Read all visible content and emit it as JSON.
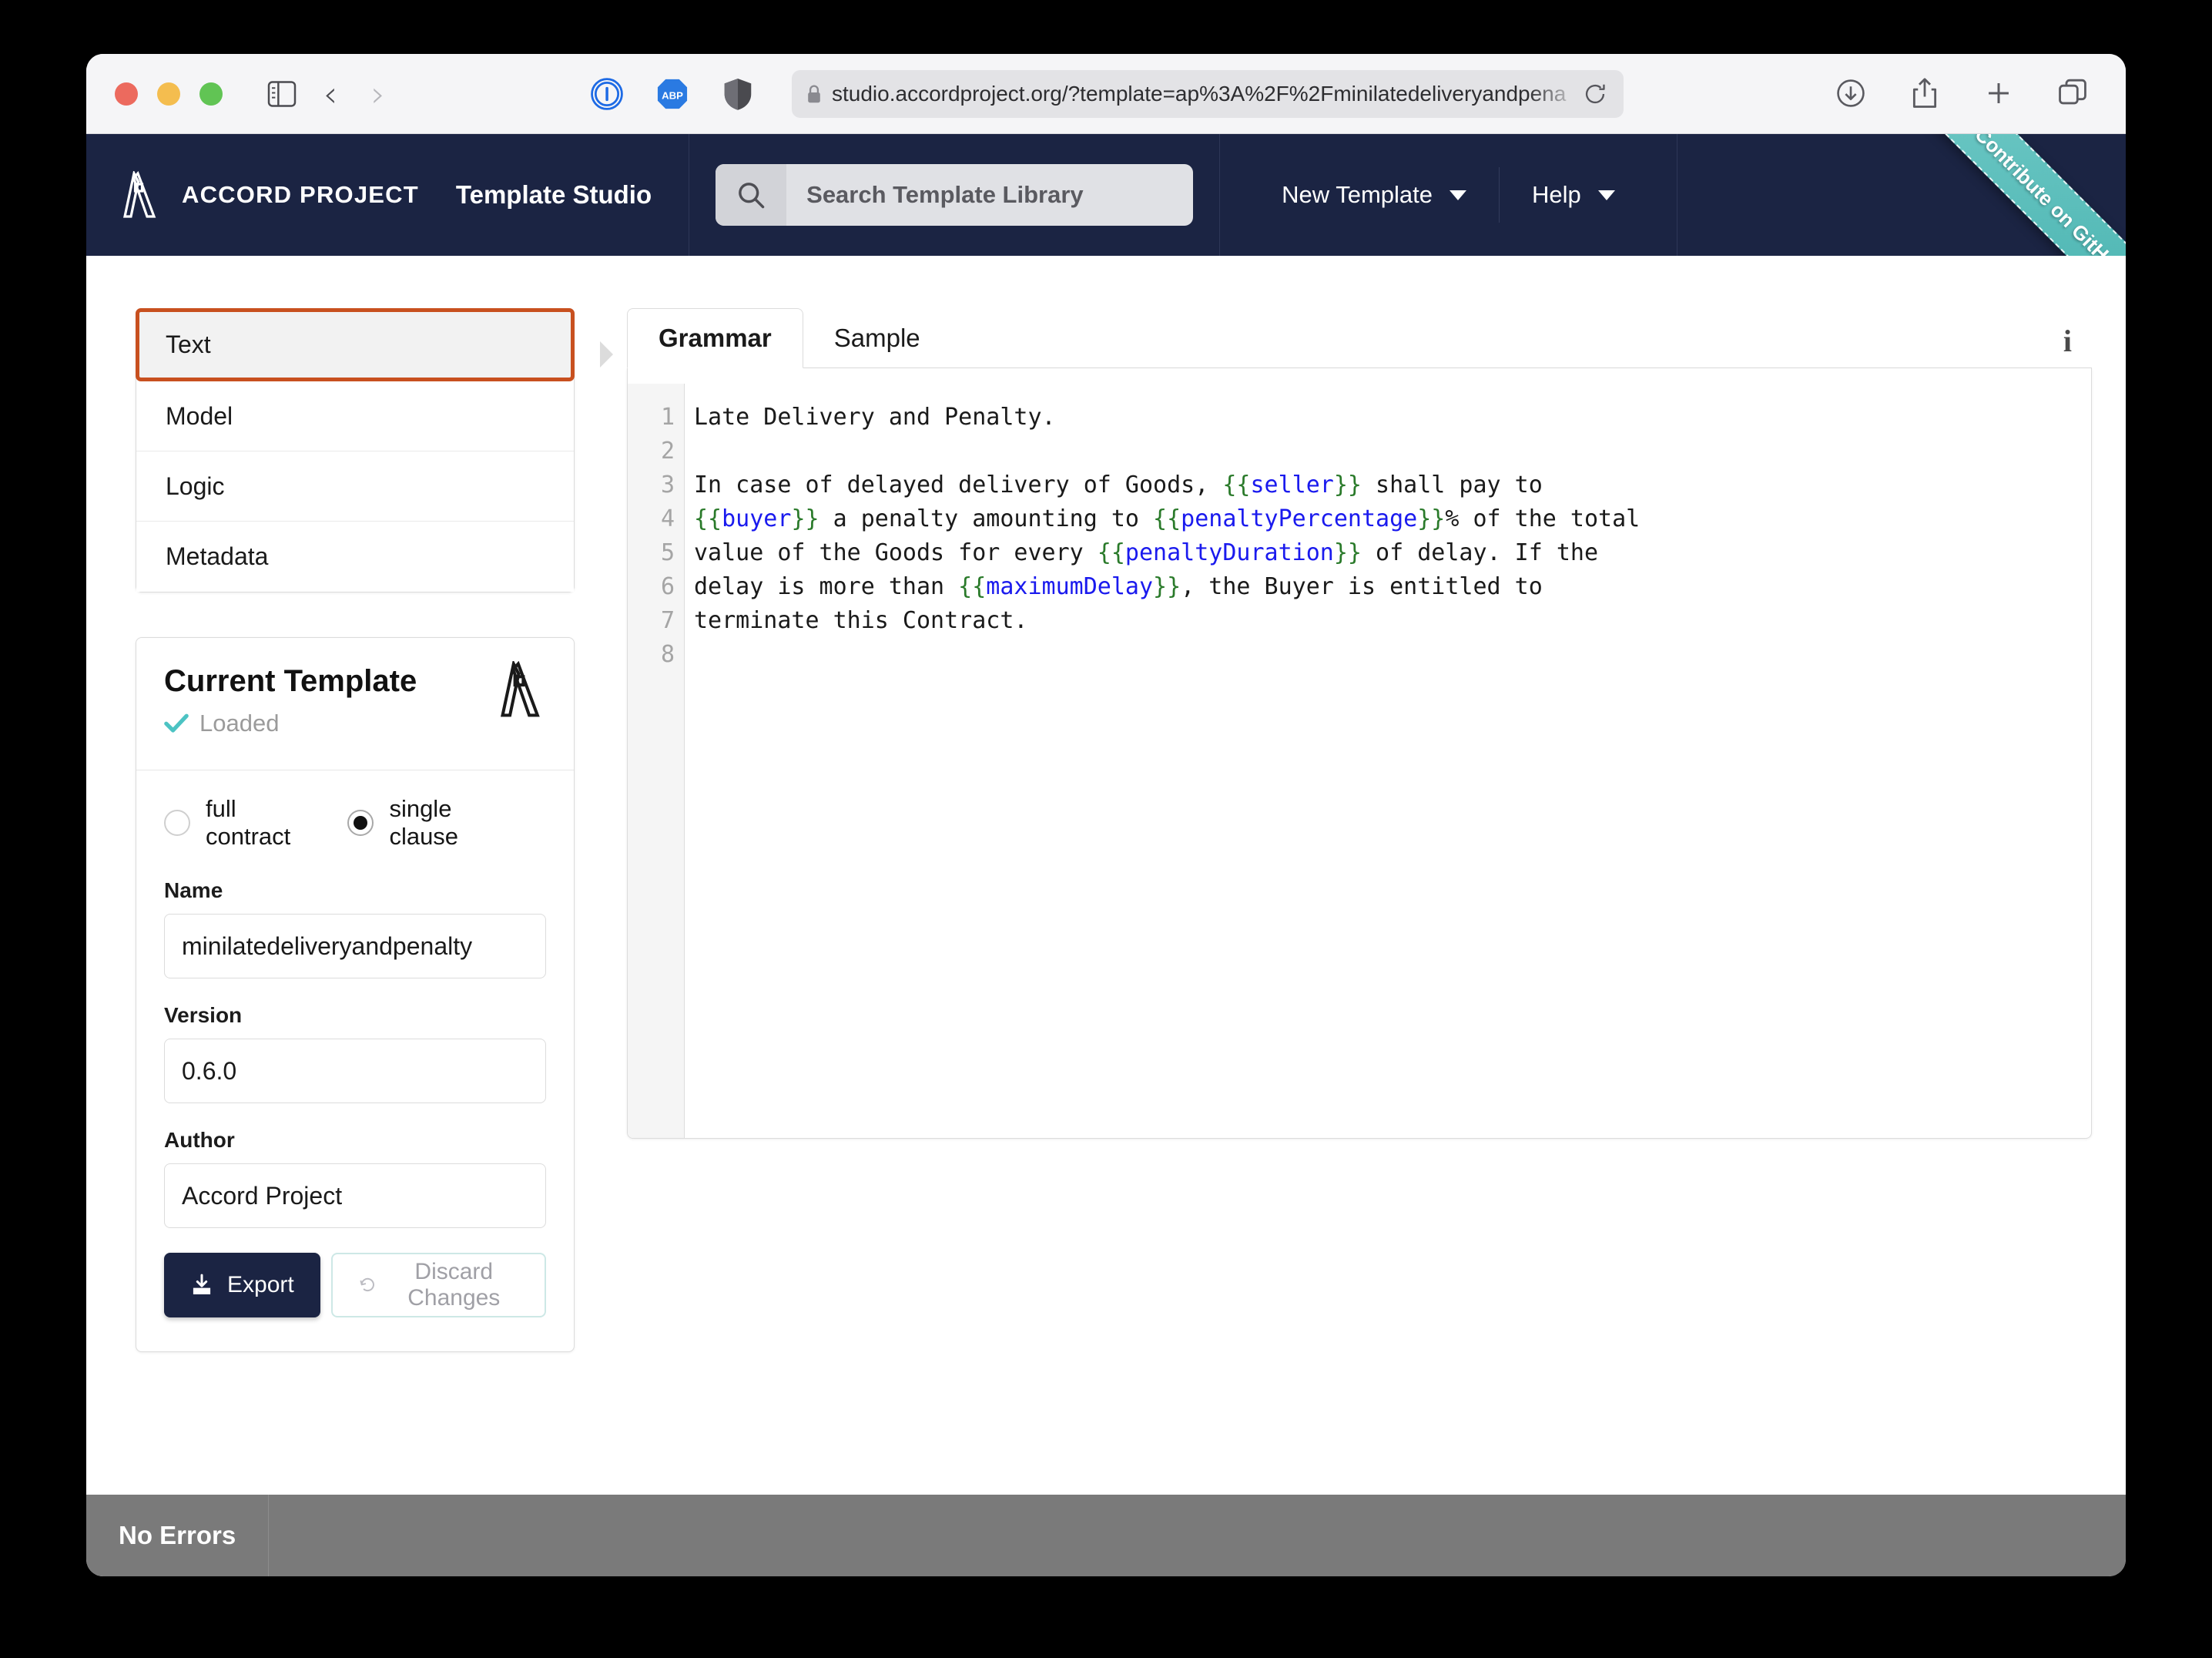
{
  "browser": {
    "url": "studio.accordproject.org/?template=ap%3A%2F%2Fminilatedeliveryandpena",
    "icons": {
      "sidebar": "sidebar-toggle-icon",
      "back": "‹",
      "forward": "›",
      "ext_1password": "1password-extension-icon",
      "ext_adblock": "ABP",
      "ext_shield": "privacy-shield-icon",
      "lock": "lock-icon",
      "reload": "reload-icon",
      "downloads": "downloads-icon",
      "share": "share-icon",
      "new_tab": "+",
      "tab_overview": "tab-overview-icon"
    }
  },
  "header": {
    "brand_name": "ACCORD PROJECT",
    "brand_sub": "Template Studio",
    "search": {
      "placeholder": "Search Template Library",
      "value": ""
    },
    "nav": [
      {
        "label": "New Template"
      },
      {
        "label": "Help"
      }
    ],
    "ribbon": "Contribute on GitHub",
    "colors": {
      "bar": "#1b2443",
      "ribbon": "#49b3b0"
    }
  },
  "sidebar": {
    "nav_items": [
      {
        "label": "Text",
        "active": true
      },
      {
        "label": "Model",
        "active": false
      },
      {
        "label": "Logic",
        "active": false
      },
      {
        "label": "Metadata",
        "active": false
      }
    ],
    "active_accent": "#c8501f",
    "card": {
      "title": "Current Template",
      "status": "Loaded",
      "radios": [
        {
          "label": "full contract",
          "checked": false
        },
        {
          "label": "single clause",
          "checked": true
        }
      ],
      "fields": [
        {
          "label": "Name",
          "value": "minilatedeliveryandpenalty"
        },
        {
          "label": "Version",
          "value": "0.6.0"
        },
        {
          "label": "Author",
          "value": "Accord Project"
        }
      ],
      "export_label": "Export",
      "discard_label": "Discard Changes"
    }
  },
  "editor": {
    "tabs": [
      {
        "label": "Grammar",
        "active": true
      },
      {
        "label": "Sample",
        "active": false
      }
    ],
    "info_icon": "info-icon",
    "line_numbers": [
      "1",
      "2",
      "3",
      "4",
      "5",
      "6",
      "7",
      "8"
    ],
    "lines": [
      [
        {
          "t": "Late Delivery and Penalty.",
          "k": "plain"
        }
      ],
      [],
      [
        {
          "t": "In case of delayed delivery of Goods, ",
          "k": "plain"
        },
        {
          "t": "{{",
          "k": "brace"
        },
        {
          "t": "seller",
          "k": "name"
        },
        {
          "t": "}}",
          "k": "brace"
        },
        {
          "t": " shall pay to",
          "k": "plain"
        }
      ],
      [
        {
          "t": "{{",
          "k": "brace"
        },
        {
          "t": "buyer",
          "k": "name"
        },
        {
          "t": "}}",
          "k": "brace"
        },
        {
          "t": " a penalty amounting to ",
          "k": "plain"
        },
        {
          "t": "{{",
          "k": "brace"
        },
        {
          "t": "penaltyPercentage",
          "k": "name"
        },
        {
          "t": "}}",
          "k": "brace"
        },
        {
          "t": "% of the total",
          "k": "plain"
        }
      ],
      [
        {
          "t": "value of the Goods for every ",
          "k": "plain"
        },
        {
          "t": "{{",
          "k": "brace"
        },
        {
          "t": "penaltyDuration",
          "k": "name"
        },
        {
          "t": "}}",
          "k": "brace"
        },
        {
          "t": " of delay. If the",
          "k": "plain"
        }
      ],
      [
        {
          "t": "delay is more than ",
          "k": "plain"
        },
        {
          "t": "{{",
          "k": "brace"
        },
        {
          "t": "maximumDelay",
          "k": "name"
        },
        {
          "t": "}}",
          "k": "brace"
        },
        {
          "t": ", the Buyer is entitled to",
          "k": "plain"
        }
      ],
      [
        {
          "t": "terminate this Contract.",
          "k": "plain"
        }
      ],
      []
    ],
    "colors": {
      "brace": "#2a7a2a",
      "variable": "#1a1aee"
    }
  },
  "statusbar": {
    "message": "No Errors",
    "background": "#7a7a7a"
  }
}
